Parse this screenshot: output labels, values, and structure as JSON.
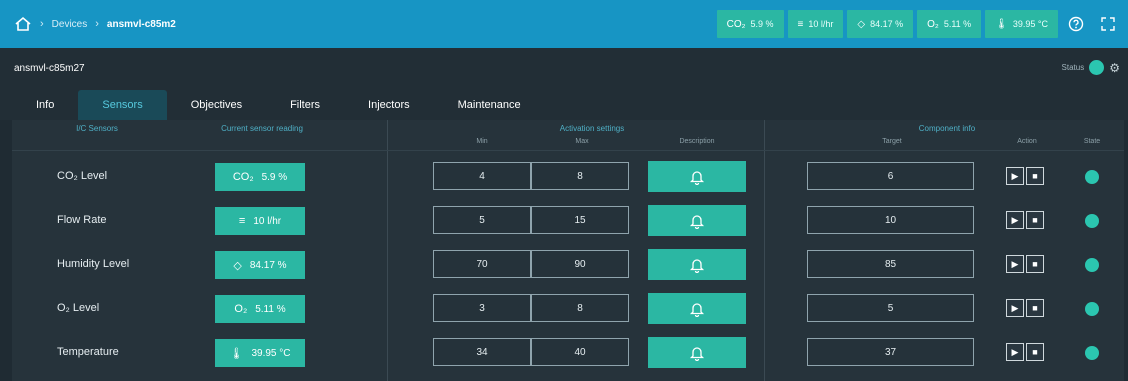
{
  "breadcrumb": {
    "section": "Devices",
    "device": "ansmvl-c85m2"
  },
  "topbar_chips": [
    {
      "icon": "CO₂",
      "value": "5.9 %"
    },
    {
      "icon": "≡",
      "value": "10 l/hr"
    },
    {
      "icon": "◇",
      "value": "84.17 %"
    },
    {
      "icon": "O₂",
      "value": "5.11 %"
    },
    {
      "icon": "🌡",
      "value": "39.95 °C"
    }
  ],
  "device": {
    "name": "ansmvl-c85m27",
    "status_label": "Status"
  },
  "tabs": [
    "Info",
    "Sensors",
    "Objectives",
    "Filters",
    "Injectors",
    "Maintenance"
  ],
  "active_tab": "Sensors",
  "headers": {
    "sensor": "I/C Sensors",
    "reading": "Current sensor reading",
    "activation": "Activation settings",
    "min": "Min",
    "max": "Max",
    "description": "Description",
    "component": "Component info",
    "target": "Target",
    "action": "Action",
    "state": "State"
  },
  "rows": [
    {
      "name": "CO₂ Level",
      "icon": "CO₂",
      "reading": "5.9 %",
      "min": "4",
      "max": "8",
      "target": "6"
    },
    {
      "name": "Flow Rate",
      "icon": "≡",
      "reading": "10 l/hr",
      "min": "5",
      "max": "15",
      "target": "10"
    },
    {
      "name": "Humidity Level",
      "icon": "◇",
      "reading": "84.17 %",
      "min": "70",
      "max": "90",
      "target": "85"
    },
    {
      "name": "O₂ Level",
      "icon": "O₂",
      "reading": "5.11 %",
      "min": "3",
      "max": "8",
      "target": "5"
    },
    {
      "name": "Temperature",
      "icon": "🌡",
      "reading": "39.95 °C",
      "min": "34",
      "max": "40",
      "target": "37"
    }
  ],
  "colors": {
    "accent": "#2bb7a3",
    "topbar": "#1795c4",
    "background": "#1f2b33"
  }
}
